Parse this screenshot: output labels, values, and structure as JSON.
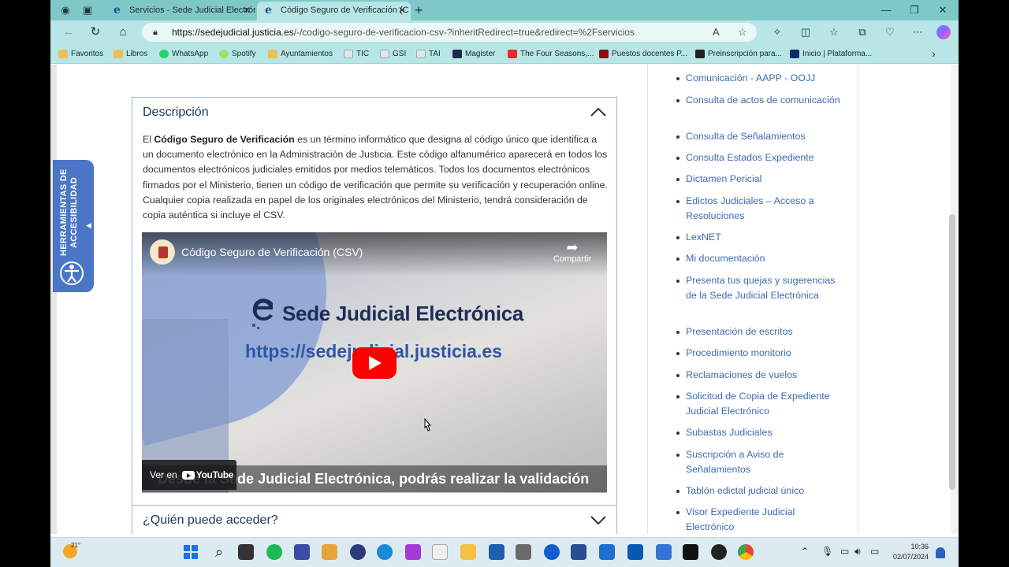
{
  "browser": {
    "tabs": [
      {
        "title": "Servicios - Sede Judicial Electrón",
        "active": false
      },
      {
        "title": "Código Seguro de Verificación (C",
        "active": true
      }
    ],
    "url_host": "https://sedejudicial.justicia.es",
    "url_path": "/-/codigo-seguro-de-verificacion-csv-?inheritRedirect=true&redirect=%2Fservicios",
    "bookmarks": [
      {
        "label": "Favoritos",
        "icon": "folder-icon"
      },
      {
        "label": "Libros",
        "icon": "folder-icon"
      },
      {
        "label": "WhatsApp",
        "icon": "whatsapp-icon"
      },
      {
        "label": "Spotify",
        "icon": "spotify-icon"
      },
      {
        "label": "Ayuntamientos",
        "icon": "folder-icon"
      },
      {
        "label": "TIC",
        "icon": "page-icon"
      },
      {
        "label": "GSI",
        "icon": "page-icon"
      },
      {
        "label": "TAI",
        "icon": "page-icon"
      },
      {
        "label": "Magister",
        "icon": "bank-icon"
      },
      {
        "label": "The Four Seasons,...",
        "icon": "youtube-icon"
      },
      {
        "label": "Puestos docentes P...",
        "icon": "site-icon"
      },
      {
        "label": "Preinscripción para...",
        "icon": "site-icon"
      },
      {
        "label": "Inicio | Plataforma...",
        "icon": "site-icon"
      }
    ]
  },
  "accessibility": {
    "label": "HERRAMIENTAS DE ACCESIBILIDAD"
  },
  "descripcion": {
    "title": "Descripción",
    "text_pre": "El ",
    "text_bold": "Código Seguro de Verificación",
    "text_post": " es un término informático que designa al código único que identifica a un documento electrónico en la Administración de Justicia. Este código alfanumérico aparecerá en todos los documentos electrónicos judiciales emitidos por medios telemáticos. Todos los documentos electrónicos firmados por el Ministerio, tienen un código de verificación que permite su verificación y recuperación online. Cualquier copia realizada en papel de los originales electrónicos del Ministerio, tendrá consideración de copia auténtica si incluye el CSV."
  },
  "video": {
    "title": "Código Seguro de Verificación (CSV)",
    "share": "Compartir",
    "brand": "Sede Judicial Electrónica",
    "url": "https://sedejudicial.justicia.es",
    "subtitle": "Desde la Sede Judicial Electrónica, podrás realizar la validación",
    "watch_on": "Ver en",
    "youtube": "YouTube"
  },
  "quien": {
    "title": "¿Quién puede acceder?"
  },
  "services": [
    "Comunicación - AAPP - OOJJ",
    "Consulta de actos de comunicación",
    "Consulta de Señalamientos",
    "Consulta Estados Expediente",
    "Dictamen Pericial",
    "Edictos Judiciales – Acceso a Resoluciones",
    "LexNET",
    "Mi documentación",
    "Presenta tus quejas y sugerencias de la Sede Judicial Electrónica",
    "Presentación de escritos",
    "Procedimiento monitorio",
    "Reclamaciones de vuelos",
    "Solicitud de Copia de Expediente Judicial Electrónico",
    "Subastas Judiciales",
    "Suscripción a Aviso de Señalamientos",
    "Tablón edictal judicial único",
    "Visor Expediente Judicial Electrónico"
  ],
  "taskbar": {
    "temperature": "21°",
    "time": "10:36",
    "date": "02/07/2024"
  }
}
